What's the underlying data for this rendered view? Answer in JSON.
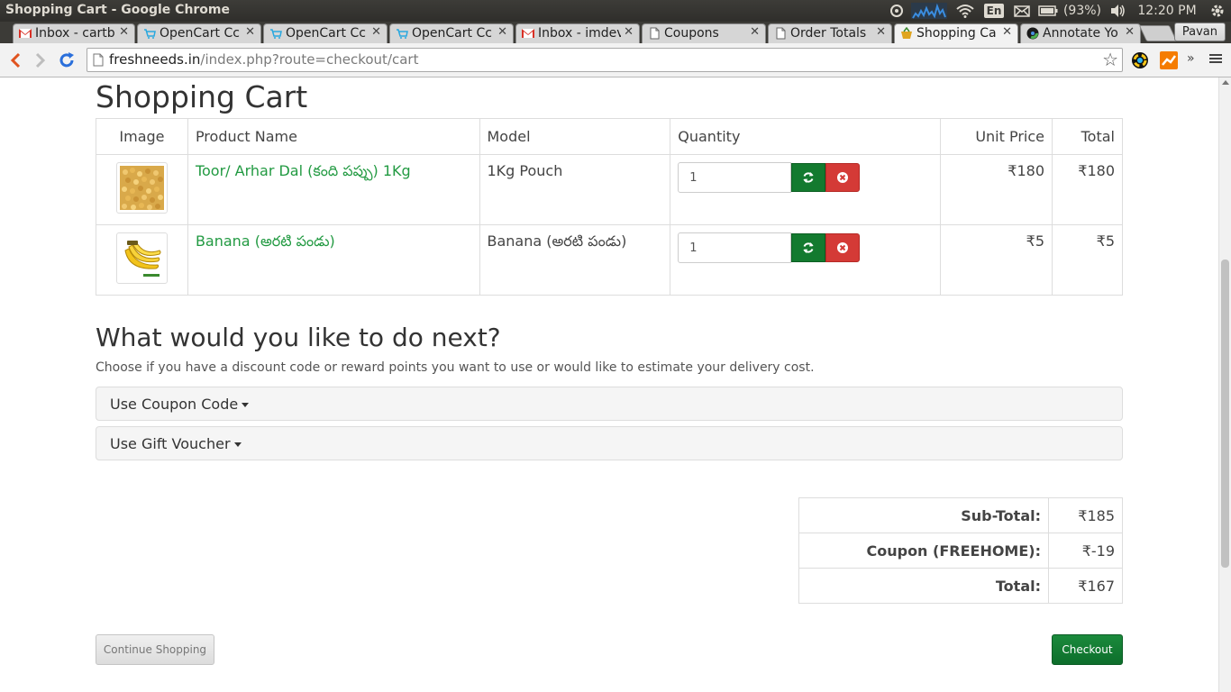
{
  "window": {
    "title": "Shopping Cart - Google Chrome",
    "tray": {
      "battery": "(93%)",
      "time": "12:20 PM",
      "language": "En",
      "user": "Pavan"
    }
  },
  "tabs": [
    {
      "label": "Inbox - cartb",
      "icon": "gmail-icon",
      "active": false
    },
    {
      "label": "OpenCart Cc",
      "icon": "opencart-cart-icon",
      "active": false
    },
    {
      "label": "OpenCart Cc",
      "icon": "opencart-cart-icon",
      "active": false
    },
    {
      "label": "OpenCart Cc",
      "icon": "opencart-cart-icon",
      "active": false
    },
    {
      "label": "Inbox - imdev",
      "icon": "gmail-icon",
      "active": false
    },
    {
      "label": "Coupons",
      "icon": "page-icon",
      "active": false
    },
    {
      "label": "Order Totals",
      "icon": "page-icon",
      "active": false
    },
    {
      "label": "Shopping Ca",
      "icon": "basket-icon",
      "active": true
    },
    {
      "label": "Annotate Yo",
      "icon": "chrome-icon",
      "active": false
    }
  ],
  "omnibox": {
    "host": "freshneeds.in",
    "path": "/index.php?route=checkout/cart"
  },
  "page": {
    "title": "Shopping Cart",
    "table_headers": [
      "Image",
      "Product Name",
      "Model",
      "Quantity",
      "Unit Price",
      "Total"
    ],
    "items": [
      {
        "name": "Toor/ Arhar Dal (కంది పప్పు) 1Kg",
        "model": "1Kg Pouch",
        "quantity": "1",
        "unit_price": "₹180",
        "total": "₹180",
        "thumb": "dal-thumbnail"
      },
      {
        "name": "Banana (అరటి పండు)",
        "model": "Banana (అరటి పండు)",
        "quantity": "1",
        "unit_price": "₹5",
        "total": "₹5",
        "thumb": "banana-thumbnail"
      }
    ],
    "next_title": "What would you like to do next?",
    "next_help": "Choose if you have a discount code or reward points you want to use or would like to estimate your delivery cost.",
    "coupon_panel": "Use Coupon Code",
    "voucher_panel": "Use Gift Voucher",
    "totals": [
      {
        "label": "Sub-Total:",
        "value": "₹185"
      },
      {
        "label": "Coupon (FREEHOME):",
        "value": "₹-19"
      },
      {
        "label": "Total:",
        "value": "₹167"
      }
    ],
    "continue_label": "Continue Shopping",
    "checkout_label": "Checkout"
  },
  "colors": {
    "link_green": "#229a42",
    "update_green": "#137a2f",
    "remove_red": "#d43a36",
    "checkout_green": "#0d6e2b"
  }
}
